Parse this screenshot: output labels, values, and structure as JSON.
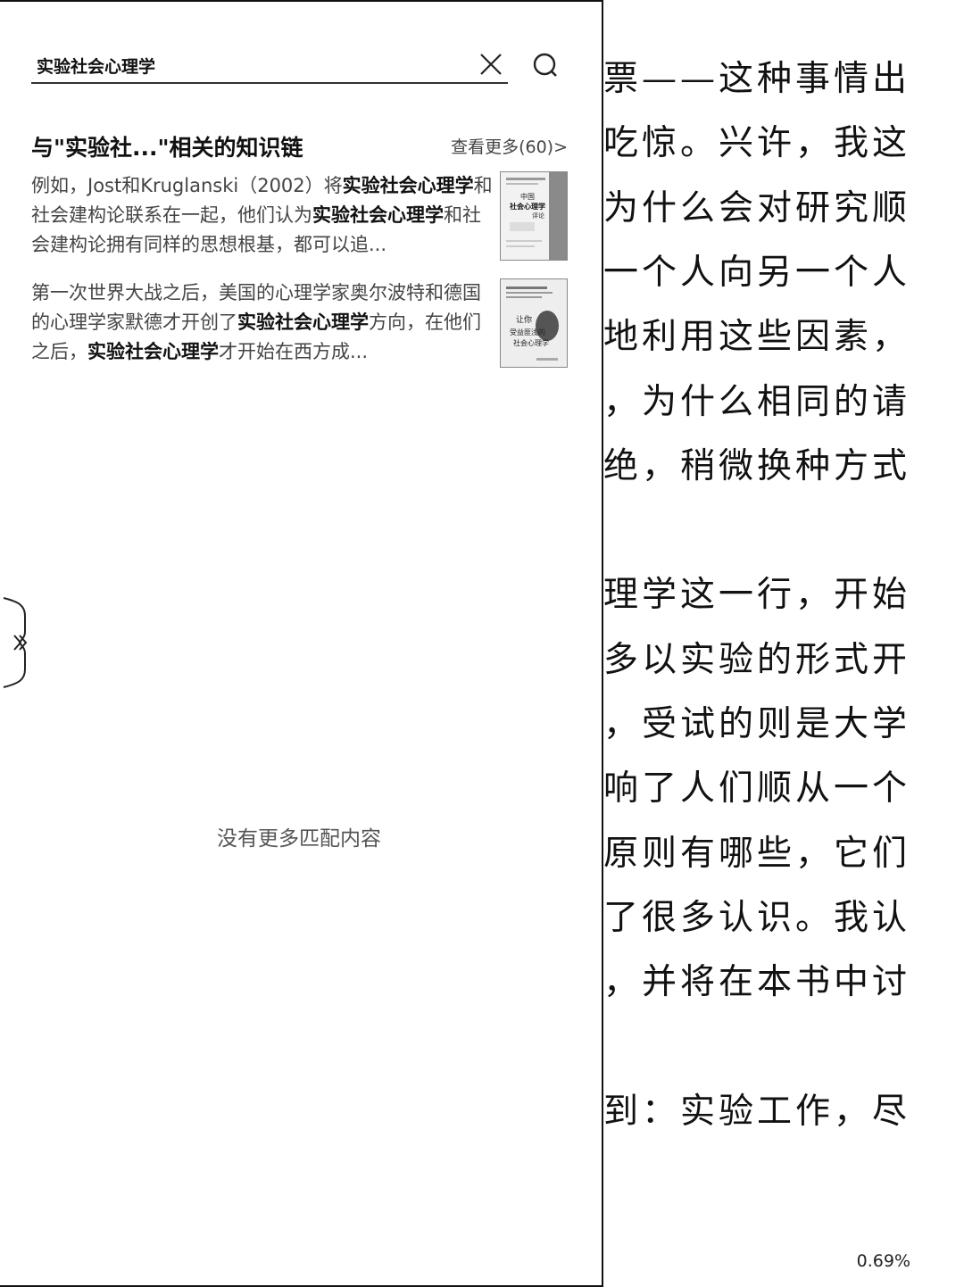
{
  "search": {
    "query": "实验社会心理学",
    "clear_icon": "close-icon",
    "submit_icon": "search-icon"
  },
  "knowledge_links": {
    "title": "与\"实验社...\"相关的知识链",
    "more_label": "查看更多(60)>",
    "results": [
      {
        "segments": [
          {
            "text": "例如，Jost和Kruglanski（2002）将",
            "bold": false
          },
          {
            "text": "实验社会心理学",
            "bold": true
          },
          {
            "text": "和社会建构论联系在一起，他们认为",
            "bold": false
          },
          {
            "text": "实验社会心理学",
            "bold": true
          },
          {
            "text": "和社会建构论拥有同样的思想根基，都可以追...",
            "bold": false
          }
        ],
        "thumb_title": "中国社会心理学评论"
      },
      {
        "segments": [
          {
            "text": "第一次世界大战之后，美国的心理学家奥尔波特和德国的心理学家默德才开创了",
            "bold": false
          },
          {
            "text": "实验社会心理学",
            "bold": true
          },
          {
            "text": "方向，在他们之后，",
            "bold": false
          },
          {
            "text": "实验社会心理学",
            "bold": true
          },
          {
            "text": "才开始在西方成...",
            "bold": false
          }
        ],
        "thumb_title": "社会心理学"
      }
    ]
  },
  "empty_message": "没有更多匹配内容",
  "reader": {
    "lines": [
      "票——这种事情出",
      "吃惊。兴许，我这",
      "为什么会对研究顺",
      "一个人向另一个人",
      "地利用这些因素，",
      "，为什么相同的请",
      "绝，稍微换种方式",
      "",
      "理学这一行，开始",
      "多以实验的形式开",
      "，受试的则是大学",
      "响了人们顺从一个",
      "原则有哪些，它们",
      "了很多认识。我认",
      "，并将在本书中讨",
      "",
      "到：实验工作，尽"
    ],
    "progress": "0.69%"
  },
  "collapse_icon": "double-chevron-right-icon"
}
